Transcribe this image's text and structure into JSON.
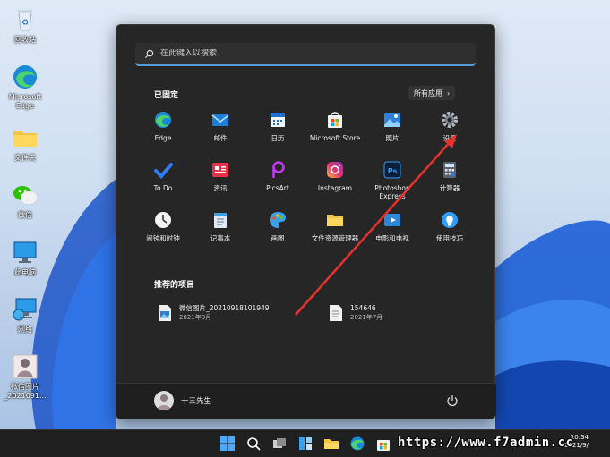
{
  "desktop": {
    "icons": [
      {
        "name": "recycle-bin",
        "label": "回收站"
      },
      {
        "name": "edge",
        "label": "Microsoft\nEdge"
      },
      {
        "name": "folder",
        "label": "文件夹"
      },
      {
        "name": "wechat",
        "label": "微信"
      },
      {
        "name": "this-pc",
        "label": "此电脑"
      },
      {
        "name": "network",
        "label": "网络"
      },
      {
        "name": "wechat-image",
        "label": "微信图片\n_2021091..."
      }
    ]
  },
  "start_menu": {
    "search_placeholder": "在此键入以搜索",
    "pinned_title": "已固定",
    "all_apps_label": "所有应用",
    "pinned": [
      {
        "label": "Edge",
        "icon": "edge-icon"
      },
      {
        "label": "邮件",
        "icon": "mail-icon"
      },
      {
        "label": "日历",
        "icon": "calendar-icon"
      },
      {
        "label": "Microsoft Store",
        "icon": "store-icon"
      },
      {
        "label": "照片",
        "icon": "photos-icon"
      },
      {
        "label": "设置",
        "icon": "gear-icon"
      },
      {
        "label": "To Do",
        "icon": "todo-icon"
      },
      {
        "label": "资讯",
        "icon": "news-icon"
      },
      {
        "label": "PicsArt",
        "icon": "picsart-icon"
      },
      {
        "label": "Instagram",
        "icon": "instagram-icon"
      },
      {
        "label": "Photoshop\nExpress",
        "icon": "photoshop-icon"
      },
      {
        "label": "计算器",
        "icon": "calculator-icon"
      },
      {
        "label": "闹钟和时钟",
        "icon": "clock-icon"
      },
      {
        "label": "记事本",
        "icon": "notepad-icon"
      },
      {
        "label": "画图",
        "icon": "paint-icon"
      },
      {
        "label": "文件资源管理器",
        "icon": "explorer-icon"
      },
      {
        "label": "电影和电视",
        "icon": "movies-icon"
      },
      {
        "label": "使用技巧",
        "icon": "tips-icon"
      }
    ],
    "recommended_title": "推荐的项目",
    "recommended": [
      {
        "title": "微信图片_20210918101949",
        "sub": "2021年9月"
      },
      {
        "title": "154646",
        "sub": "2021年7月"
      }
    ],
    "user_name": "十三先生"
  },
  "taskbar": {
    "time": "10:34",
    "date": "2021/9/"
  },
  "watermark": "https://www.f7admin.cc",
  "colors": {
    "accent": "#0078d4",
    "menu_bg": "#262626",
    "arrow": "#e5322d"
  }
}
